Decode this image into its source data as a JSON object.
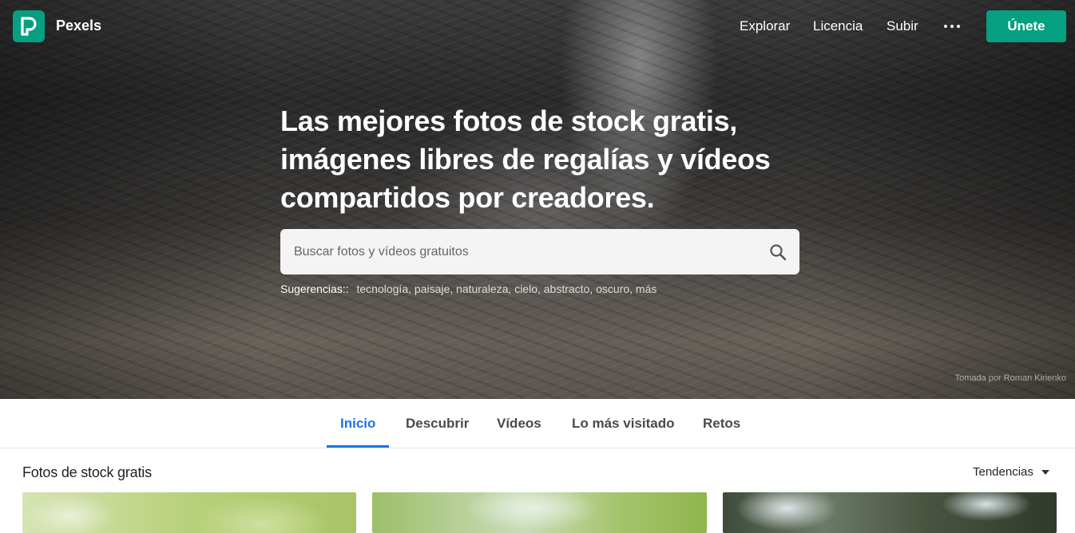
{
  "header": {
    "brand": "Pexels",
    "nav": [
      "Explorar",
      "Licencia",
      "Subir"
    ],
    "more_icon": "more-horizontal-icon",
    "join_label": "Únete"
  },
  "hero": {
    "headline_lines": [
      "Las mejores fotos de stock gratis,",
      "imágenes libres de regalías y vídeos",
      "compartidos por creadores."
    ],
    "search": {
      "placeholder": "Buscar fotos y vídeos gratuitos",
      "value": "",
      "icon": "search-icon"
    },
    "suggestions_label": "Sugerencias::",
    "suggestions": "tecnología, paisaje, naturaleza, cielo, abstracto, oscuro, más",
    "credit": "Tomada por Roman Kirienko"
  },
  "tabs": {
    "items": [
      "Inicio",
      "Descubrir",
      "Vídeos",
      "Lo más visitado",
      "Retos"
    ],
    "active": "Inicio"
  },
  "content": {
    "section_title": "Fotos de stock gratis",
    "sort_label": "Tendencias"
  },
  "colors": {
    "brand": "#05a081",
    "active_tab": "#1a73e8"
  }
}
